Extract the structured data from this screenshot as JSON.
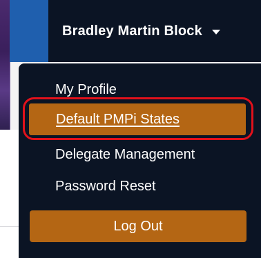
{
  "nav": {
    "user_name": "Bradley Martin Block"
  },
  "menu": {
    "items": [
      {
        "label": "My Profile"
      },
      {
        "label": "Default PMPi States"
      },
      {
        "label": "Delegate Management"
      },
      {
        "label": "Password Reset"
      }
    ],
    "logout_label": "Log Out"
  },
  "colors": {
    "nav_bg": "#0b1424",
    "accent": "#b46614",
    "highlight_ring": "#e2111b"
  }
}
